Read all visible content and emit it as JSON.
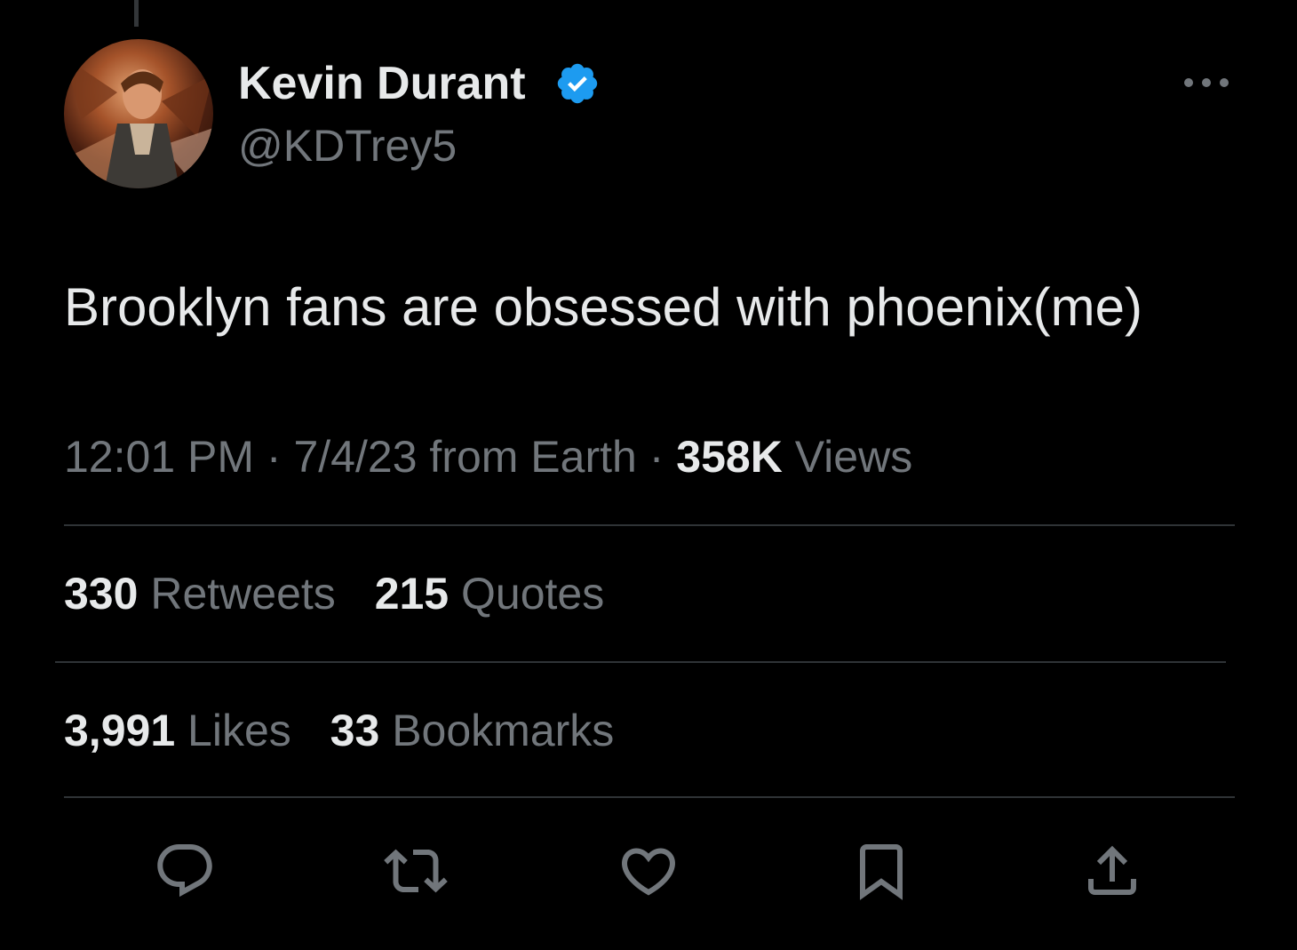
{
  "author": {
    "display_name": "Kevin Durant",
    "handle": "@KDTrey5",
    "verified": true,
    "avatar_icon": "profile-avatar"
  },
  "tweet": {
    "text": "Brooklyn fans are obsessed with phoenix(me)"
  },
  "meta": {
    "time": "12:01 PM",
    "separator": "·",
    "date": "7/4/23",
    "source": "from Earth",
    "views_count": "358K",
    "views_label": "Views"
  },
  "stats": {
    "retweets_count": "330",
    "retweets_label": "Retweets",
    "quotes_count": "215",
    "quotes_label": "Quotes",
    "likes_count": "3,991",
    "likes_label": "Likes",
    "bookmarks_count": "33",
    "bookmarks_label": "Bookmarks"
  },
  "actions": [
    {
      "icon": "reply-icon"
    },
    {
      "icon": "retweet-icon"
    },
    {
      "icon": "like-icon"
    },
    {
      "icon": "bookmark-icon"
    },
    {
      "icon": "share-icon"
    }
  ],
  "colors": {
    "background": "#000000",
    "primary_text": "#e7e9ea",
    "secondary_text": "#71767b",
    "divider": "#2f3336",
    "verified_blue": "#1d9bf0"
  }
}
